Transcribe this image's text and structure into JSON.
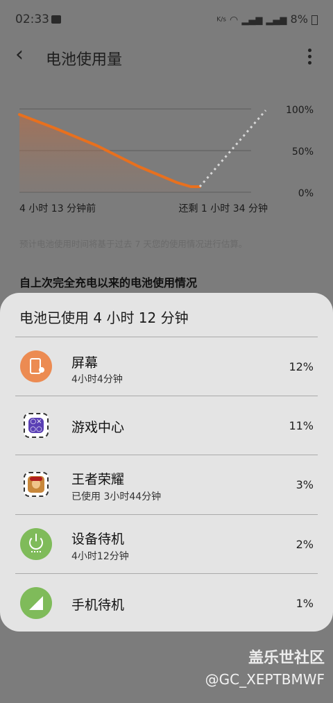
{
  "status_bar": {
    "time": "02:33",
    "network_speed": "K/s",
    "battery": "8%"
  },
  "header": {
    "title": "电池使用量"
  },
  "chart": {
    "y_labels": [
      "100%",
      "50%",
      "0%"
    ],
    "time_start": "4 小时 13 分钟前",
    "time_end": "还剩 1 小时 34 分钟",
    "line_color": "#e8701e"
  },
  "estimate_note": "预计电池使用时间将基于过去 7 天您的使用情况进行估算。",
  "section_title": "自上次完全充电以来的电池使用情况",
  "sheet": {
    "title": "电池已使用 4 小时 12 分钟",
    "items": [
      {
        "name": "屏幕",
        "sub": "4小时4分钟",
        "pct": "12%",
        "icon": "screen-icon"
      },
      {
        "name": "游戏中心",
        "sub": "",
        "pct": "11%",
        "icon": "game-center-icon"
      },
      {
        "name": "王者荣耀",
        "sub": "已使用 3小时44分钟",
        "pct": "3%",
        "icon": "honor-of-kings-icon"
      },
      {
        "name": "设备待机",
        "sub": "4小时12分钟",
        "pct": "2%",
        "icon": "power-icon"
      },
      {
        "name": "手机待机",
        "sub": "",
        "pct": "1%",
        "icon": "signal-icon"
      }
    ]
  },
  "watermark": {
    "site": "盖乐世社区",
    "user": "@GC_XEPTBMWF"
  }
}
